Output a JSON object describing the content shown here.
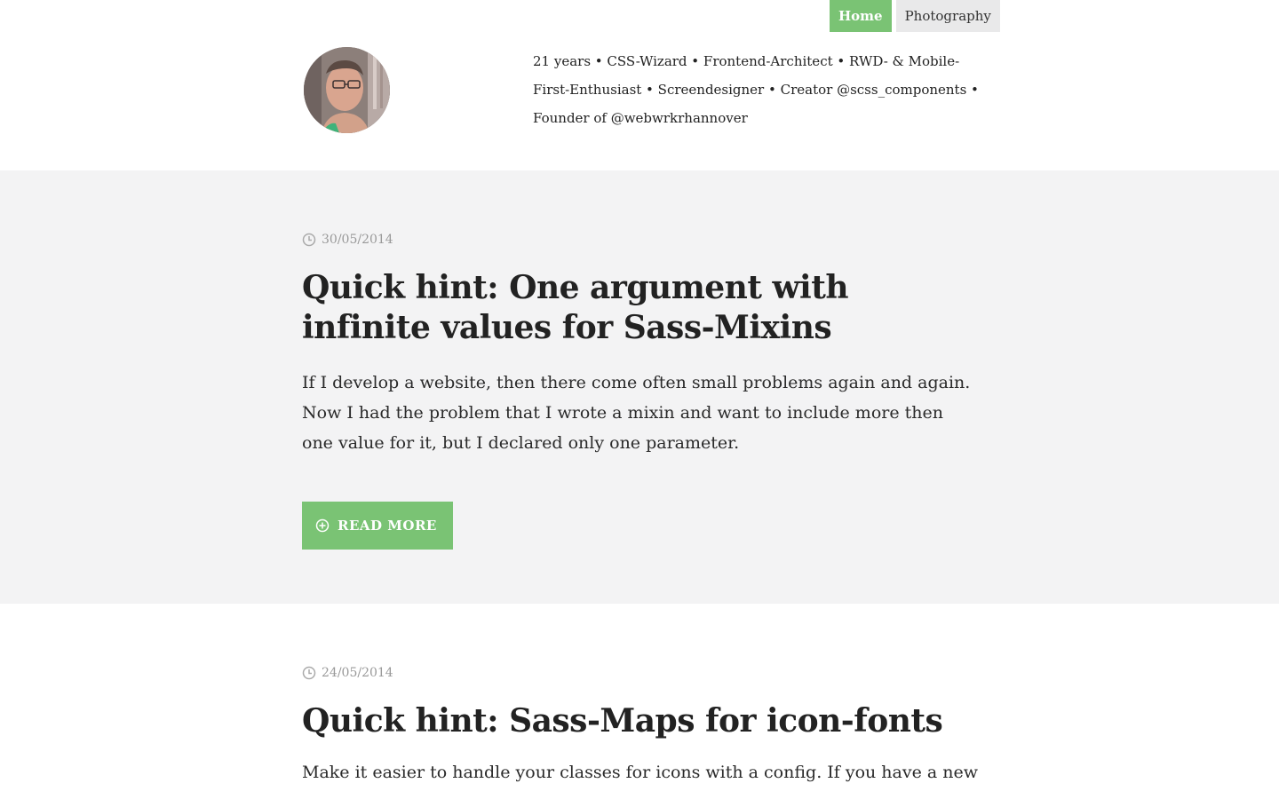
{
  "nav": {
    "items": [
      {
        "label": "Home",
        "active": true
      },
      {
        "label": "Photography",
        "active": false
      }
    ]
  },
  "header": {
    "bio": "21 years • CSS-Wizard • Frontend-Architect • RWD- & Mobile-First-Enthusiast • Screendesigner • Creator @scss_components • Founder of @webwrkrhannover"
  },
  "posts": [
    {
      "date": "30/05/2014",
      "title": "Quick hint: One argument with infinite values for Sass-Mixins",
      "excerpt": "If I develop a website, then there come often small problems again and again. Now I had the problem that I wrote a mixin and want to include more then one value for it, but I declared only one parameter.",
      "read_more_label": "READ MORE"
    },
    {
      "date": "24/05/2014",
      "title": "Quick hint: Sass-Maps for icon-fonts",
      "excerpt": "Make it easier to handle your classes for icons with a config. If you have a new"
    }
  ],
  "colors": {
    "accent": "#7ac374",
    "nav_inactive_bg": "#e9e9ea",
    "post_shaded_bg": "#f3f3f4",
    "date_text": "#999999"
  },
  "icons": {
    "date": "clock-icon",
    "read_more": "plus-circle-icon"
  }
}
